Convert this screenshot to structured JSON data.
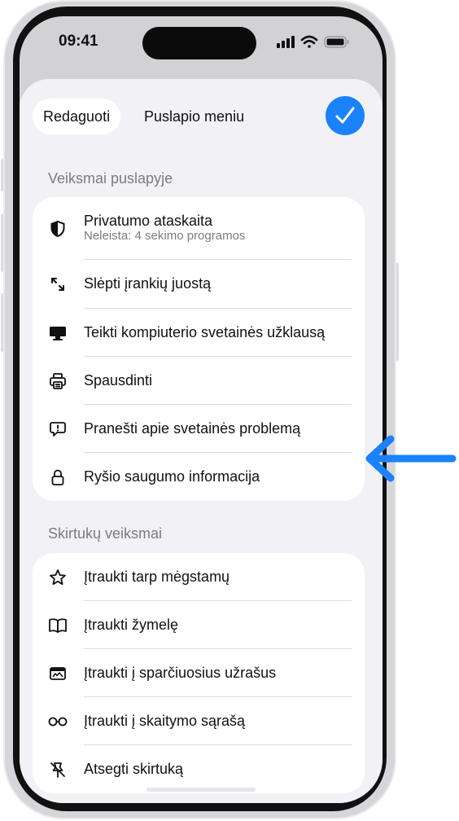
{
  "status": {
    "time": "09:41"
  },
  "header": {
    "edit_label": "Redaguoti",
    "title": "Puslapio meniu"
  },
  "page_actions": {
    "label": "Veiksmai puslapyje",
    "items": [
      {
        "label": "Privatumo ataskaita",
        "sub": "Neleista: 4 sekimo programos",
        "icon": "shield-icon"
      },
      {
        "label": "Slėpti įrankių juostą",
        "icon": "expand-arrows-icon"
      },
      {
        "label": "Teikti kompiuterio svetainės užklausą",
        "icon": "desktop-icon"
      },
      {
        "label": "Spausdinti",
        "icon": "printer-icon"
      },
      {
        "label": "Pranešti apie svetainės problemą",
        "icon": "report-bubble-icon"
      },
      {
        "label": "Ryšio saugumo informacija",
        "icon": "lock-icon"
      }
    ]
  },
  "tab_actions": {
    "label": "Skirtukų veiksmai",
    "items": [
      {
        "label": "Įtraukti tarp mėgstamų",
        "icon": "star-icon"
      },
      {
        "label": "Įtraukti žymelę",
        "icon": "book-icon"
      },
      {
        "label": "Įtraukti į sparčiuosius užrašus",
        "icon": "quick-note-icon"
      },
      {
        "label": "Įtraukti į skaitymo sąrašą",
        "icon": "glasses-icon"
      },
      {
        "label": "Atsegti skirtuką",
        "icon": "unpin-icon"
      }
    ]
  },
  "colors": {
    "accent": "#1a82fb",
    "sheet_bg": "#f2f2f6",
    "secondary_text": "#7b7b80"
  }
}
